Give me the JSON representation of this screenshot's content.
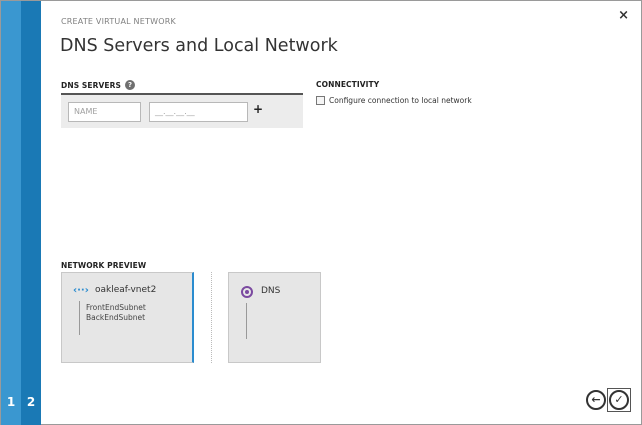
{
  "wizard": {
    "steps": [
      "1",
      "2"
    ],
    "close_glyph": "×"
  },
  "header": {
    "eyebrow": "CREATE VIRTUAL NETWORK",
    "title": "DNS Servers and Local Network"
  },
  "dns": {
    "label": "DNS SERVERS",
    "help_glyph": "?",
    "name_placeholder": "NAME",
    "ip_placeholder": "__.__.__.__",
    "add_glyph": "+"
  },
  "connectivity": {
    "label": "CONNECTIVITY",
    "checkbox_label": "Configure connection to local network",
    "checked": false
  },
  "preview": {
    "label": "NETWORK PREVIEW",
    "vnet": {
      "icon_glyph": "‹··›",
      "name": "oakleaf-vnet2",
      "subnets": [
        "FrontEndSubnet",
        "BackEndSubnet"
      ]
    },
    "dns_card": {
      "name": "DNS"
    }
  },
  "footer": {
    "back_glyph": "←",
    "ok_glyph": "✓"
  },
  "colors": {
    "step1": "#3a97d0",
    "step2": "#1a79b5",
    "accent": "#2b8ccf",
    "dns_icon": "#7b4aa0"
  }
}
